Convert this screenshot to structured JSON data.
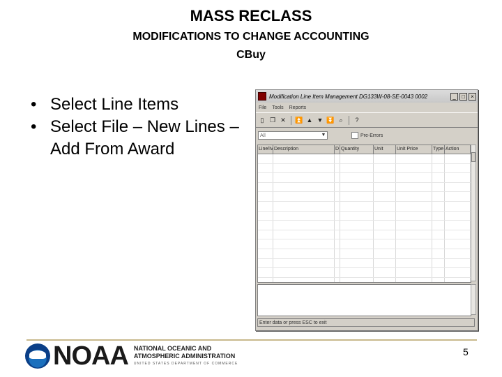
{
  "slide": {
    "title": "MASS RECLASS",
    "subtitle_line1": "MODIFICATIONS TO CHANGE ACCOUNTING",
    "subtitle_line2": "CBuy",
    "bullets": [
      {
        "prefix": "Select ",
        "emphasis": "Line Items"
      },
      {
        "text": "Select File – New Lines – Add From Award"
      }
    ],
    "page_number": "5"
  },
  "footer": {
    "logo_text": "NOAA",
    "agency_line1": "NATIONAL OCEANIC AND",
    "agency_line2": "ATMOSPHERIC ADMINISTRATION",
    "agency_line3": "UNITED STATES DEPARTMENT OF COMMERCE",
    "rule_color": "#c8b98c"
  },
  "screenshot": {
    "window_title": "Modification Line Item Management  DG133W-08-SE-0043 0002",
    "menu": [
      "File",
      "Tools",
      "Reports"
    ],
    "combo_value": "All",
    "checkbox_label": "Pre-Errors",
    "columns": [
      "Line/Ivs",
      "Description",
      "D",
      "Quantity",
      "Unit",
      "Unit Price",
      "Type",
      "Action"
    ],
    "status_text": "Enter data or press ESC to exit"
  }
}
